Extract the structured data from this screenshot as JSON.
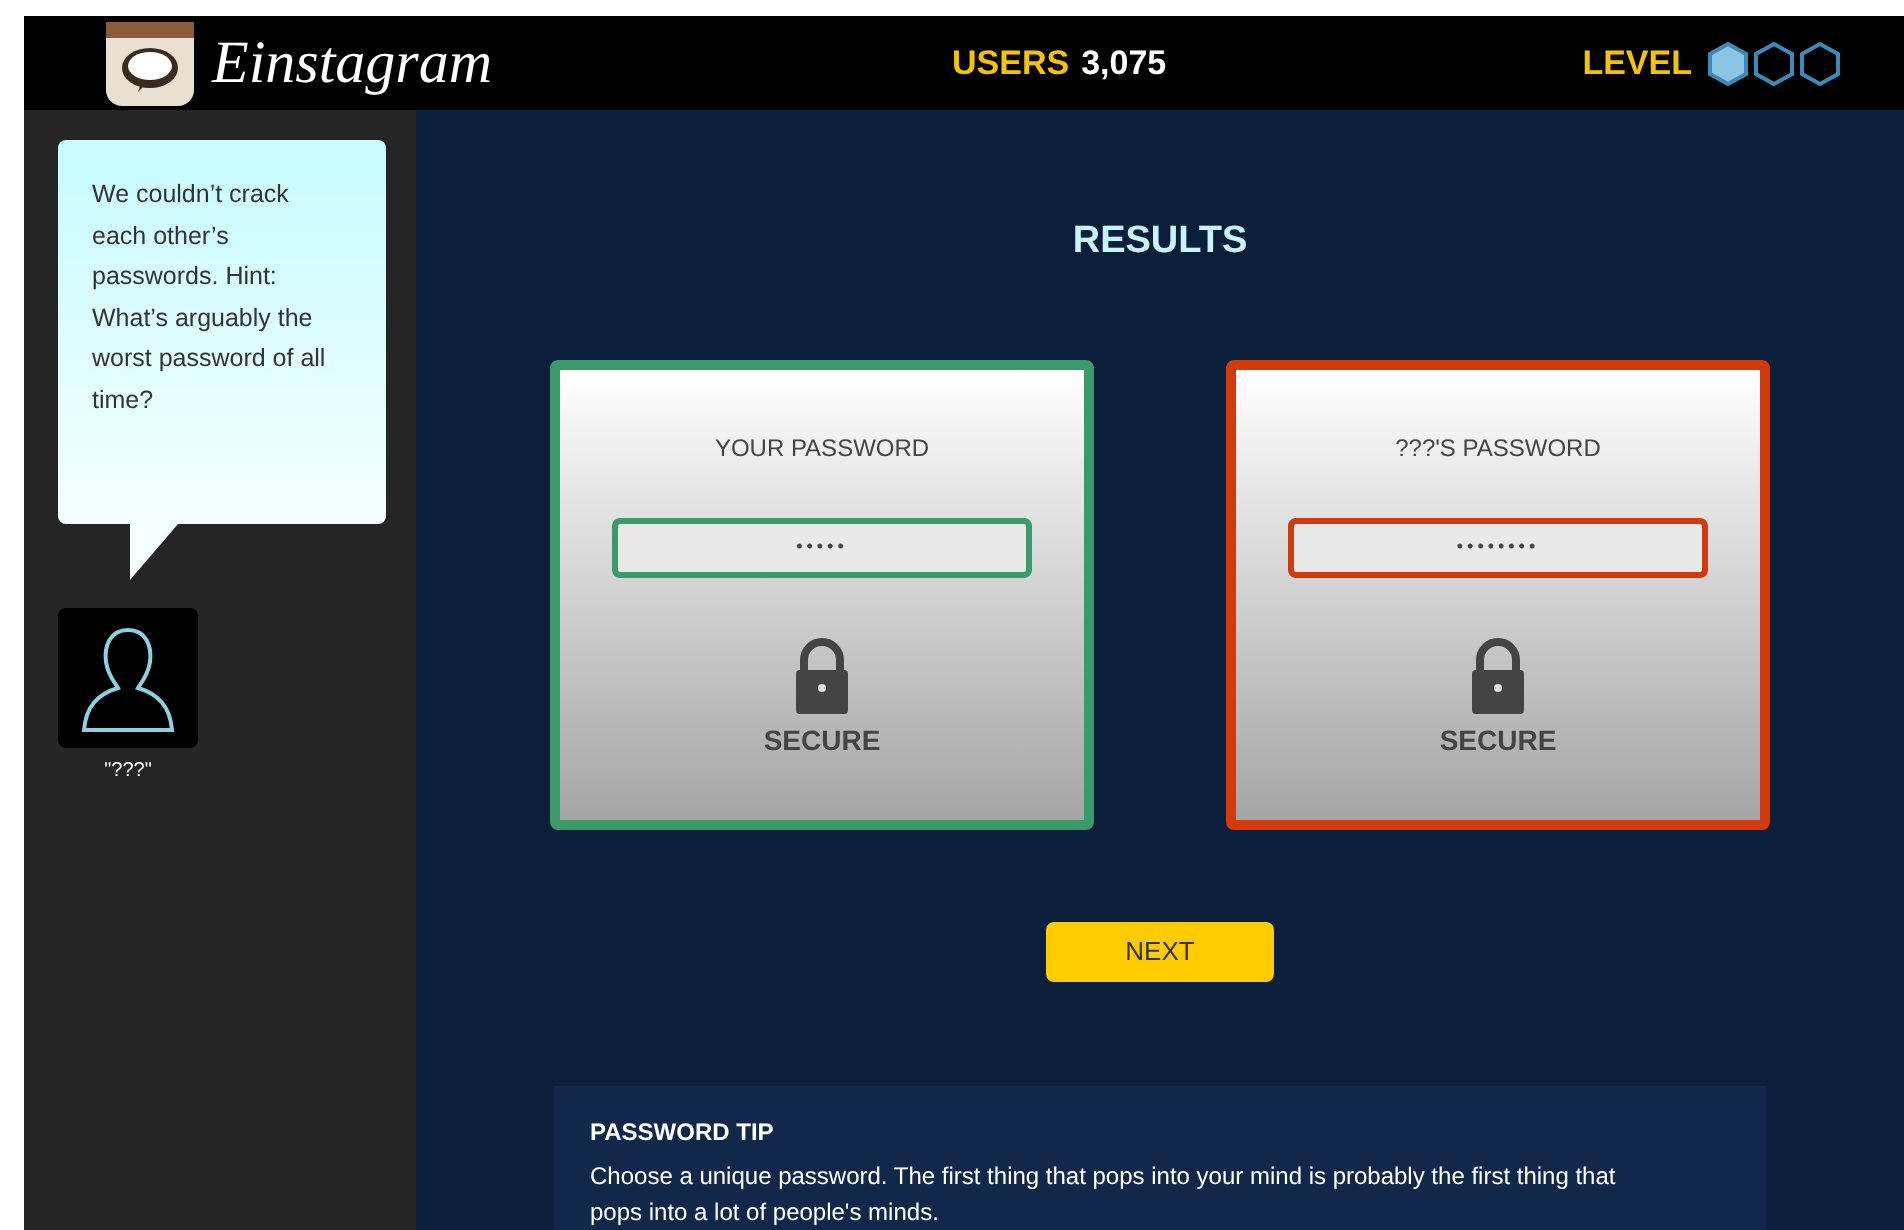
{
  "header": {
    "app_name": "Einstagram",
    "users_label": "USERS",
    "users_count": "3,075",
    "level_label": "LEVEL",
    "level_hexagons": [
      {
        "filled": true
      },
      {
        "filled": false
      },
      {
        "filled": false
      }
    ]
  },
  "sidebar": {
    "speech": "We couldn’t crack each other’s passwords. Hint: What’s arguably the worst password of all time?",
    "character_name": "\"???\""
  },
  "title": "RESULTS",
  "cards": [
    {
      "label": "YOUR PASSWORD",
      "value": "•••••",
      "status": "SECURE",
      "color": "#3a9a6a"
    },
    {
      "label": "???'S PASSWORD",
      "value": "••••••••",
      "status": "SECURE",
      "color": "#d23a0c"
    }
  ],
  "next_button": "NEXT",
  "tip": {
    "heading": "PASSWORD TIP",
    "text": "Choose a unique password. The first thing that pops into your mind is probably the first thing that pops into a lot of people's minds."
  }
}
